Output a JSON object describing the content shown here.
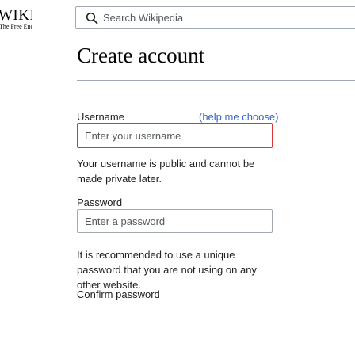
{
  "logo": {
    "wordmark": "WIKIPEDIA",
    "tagline": "The Free Encyclopedia"
  },
  "search": {
    "placeholder": "Search Wikipedia",
    "icon": "search-icon"
  },
  "page": {
    "title": "Create account"
  },
  "form": {
    "username": {
      "label": "Username",
      "help_link": "(help me choose)",
      "placeholder": "Enter your username",
      "note": "Your username is public and cannot be made private later."
    },
    "password": {
      "label": "Password",
      "placeholder": "Enter a password",
      "note": "It is recommended to use a unique password that you are not using on any other website."
    },
    "confirm_password": {
      "label": "Confirm password"
    }
  },
  "colors": {
    "link": "#3366cc",
    "border": "#a2a9b1",
    "error_border": "#d33333",
    "text": "#202122"
  }
}
